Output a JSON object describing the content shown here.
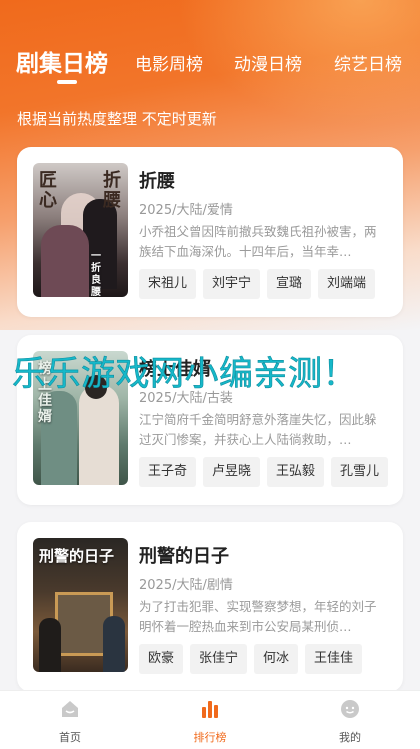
{
  "tabs": [
    {
      "label": "剧集日榜",
      "active": true
    },
    {
      "label": "电影周榜",
      "active": false
    },
    {
      "label": "动漫日榜",
      "active": false
    },
    {
      "label": "综艺日榜",
      "active": false
    }
  ],
  "subtitle": "根据当前热度整理 不定时更新",
  "cards": [
    {
      "title": "折腰",
      "meta": "2025/大陆/爱情",
      "desc": "小乔祖父曾因阵前撤兵致魏氏祖孙被害，两族结下血海深仇。十四年后，当年幸…",
      "actors": [
        "宋祖儿",
        "刘宇宁",
        "宣璐",
        "刘端端"
      ],
      "poster_text": {
        "left": "匠心",
        "right": "折腰",
        "small": "一折良腰"
      }
    },
    {
      "title": "榜上佳婿",
      "meta": "2025/大陆/古装",
      "desc": "江宁简府千金简明舒意外落崖失忆，因此躲过灭门惨案，并获心上人陆徜救助，…",
      "actors": [
        "王子奇",
        "卢昱晓",
        "王弘毅",
        "孔雪儿"
      ],
      "poster_text": {
        "left": "榜上佳婿",
        "right": "",
        "small": ""
      }
    },
    {
      "title": "刑警的日子",
      "meta": "2025/大陆/剧情",
      "desc": "为了打击犯罪、实现警察梦想，年轻的刘子明怀着一腔热血来到市公安局某刑侦…",
      "actors": [
        "欧豪",
        "张佳宁",
        "何冰",
        "王佳佳"
      ],
      "poster_text": {
        "left": "刑警的日子",
        "right": "",
        "small": ""
      }
    }
  ],
  "watermark": "乐乐游戏网小编亲测！",
  "nav": [
    {
      "label": "首页",
      "icon": "home-icon",
      "active": false
    },
    {
      "label": "排行榜",
      "icon": "ranking-icon",
      "active": true
    },
    {
      "label": "我的",
      "icon": "profile-icon",
      "active": false
    }
  ],
  "colors": {
    "accent": "#f06a1c",
    "watermark": "#16b8c9"
  }
}
